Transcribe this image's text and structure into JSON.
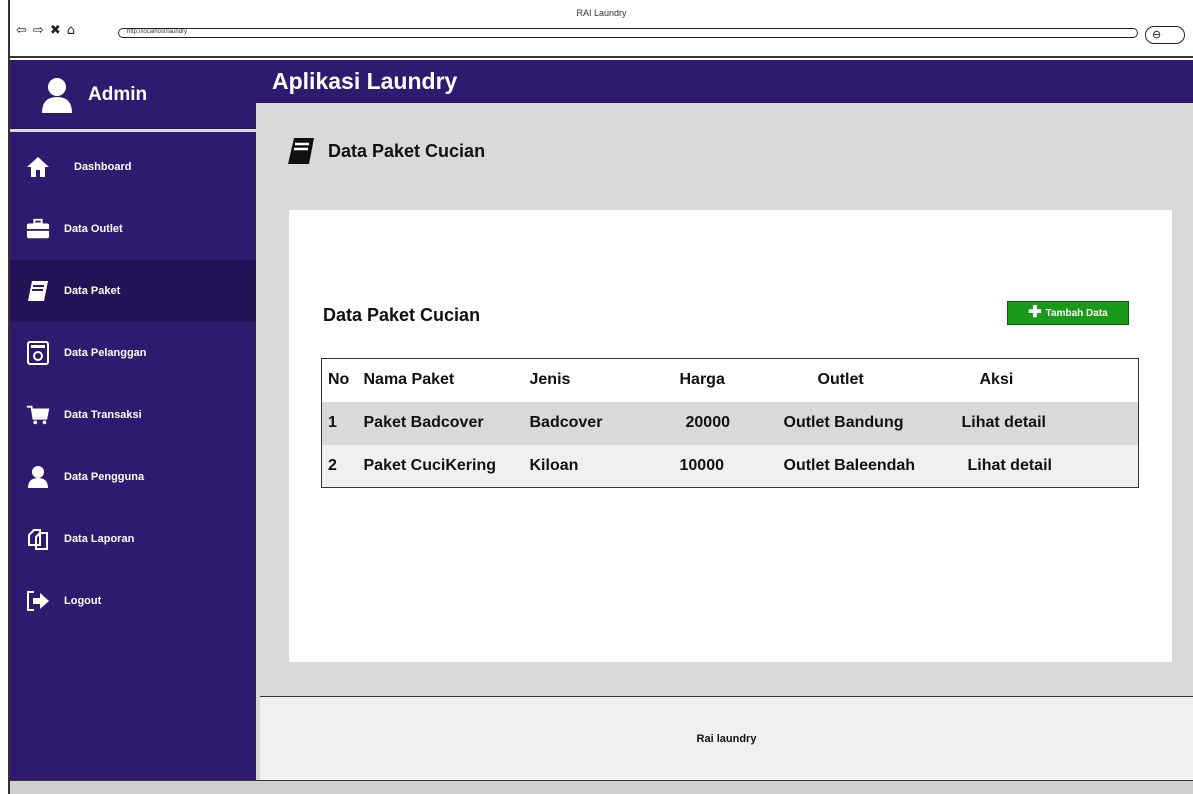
{
  "window": {
    "title": "RAI Laundry",
    "url": "http://localhost/laundry"
  },
  "sidebar": {
    "user_label": "Admin",
    "items": [
      {
        "label": "Dashboard",
        "icon": "home-icon"
      },
      {
        "label": "Data Outlet",
        "icon": "briefcase-icon"
      },
      {
        "label": "Data Paket",
        "icon": "book-icon",
        "active": true
      },
      {
        "label": "Data Pelanggan",
        "icon": "id-card-icon"
      },
      {
        "label": "Data Transaksi",
        "icon": "cart-icon"
      },
      {
        "label": "Data Pengguna",
        "icon": "user-icon"
      },
      {
        "label": "Data Laporan",
        "icon": "copy-icon"
      },
      {
        "label": "Logout",
        "icon": "logout-icon"
      }
    ]
  },
  "header": {
    "app_title": "Aplikasi Laundry"
  },
  "page": {
    "heading": "Data Paket Cucian"
  },
  "card": {
    "title": "Data Paket Cucian",
    "add_button_label": "Tambah Data"
  },
  "table": {
    "columns": [
      "No",
      "Nama Paket",
      "Jenis",
      "Harga",
      "Outlet",
      "Aksi"
    ],
    "rows": [
      {
        "no": "1",
        "nama": "Paket Badcover",
        "jenis": "Badcover",
        "harga": "20000",
        "outlet": "Outlet Bandung",
        "aksi": "Lihat detail"
      },
      {
        "no": "2",
        "nama": "Paket CuciKering",
        "jenis": "Kiloan",
        "harga": "10000",
        "outlet": "Outlet Baleendah",
        "aksi": "Lihat detail"
      }
    ]
  },
  "footer": {
    "text": "Rai laundry"
  },
  "colors": {
    "sidebar": "#2e1a6e",
    "sidebar_active": "#231255",
    "add_button": "#1a9a1a",
    "content_bg": "#d9d9d9"
  }
}
